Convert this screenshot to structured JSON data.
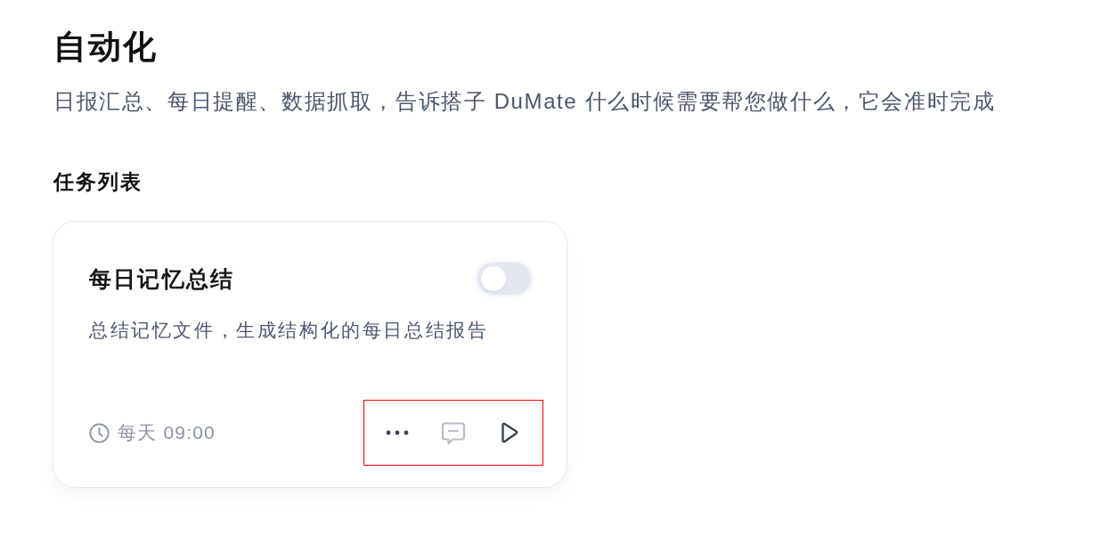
{
  "page": {
    "title": "自动化",
    "subtitle": "日报汇总、每日提醒、数据抓取，告诉搭子 DuMate 什么时候需要帮您做什么，它会准时完成"
  },
  "section": {
    "title": "任务列表"
  },
  "tasks": [
    {
      "title": "每日记忆总结",
      "enabled": false,
      "description": "总结记忆文件，生成结构化的每日总结报告",
      "schedule": "每天 09:00",
      "actions_highlighted": true,
      "actions": [
        {
          "kind": "more",
          "disabled": false
        },
        {
          "kind": "comment",
          "disabled": true
        },
        {
          "kind": "run",
          "disabled": false
        }
      ]
    }
  ]
}
